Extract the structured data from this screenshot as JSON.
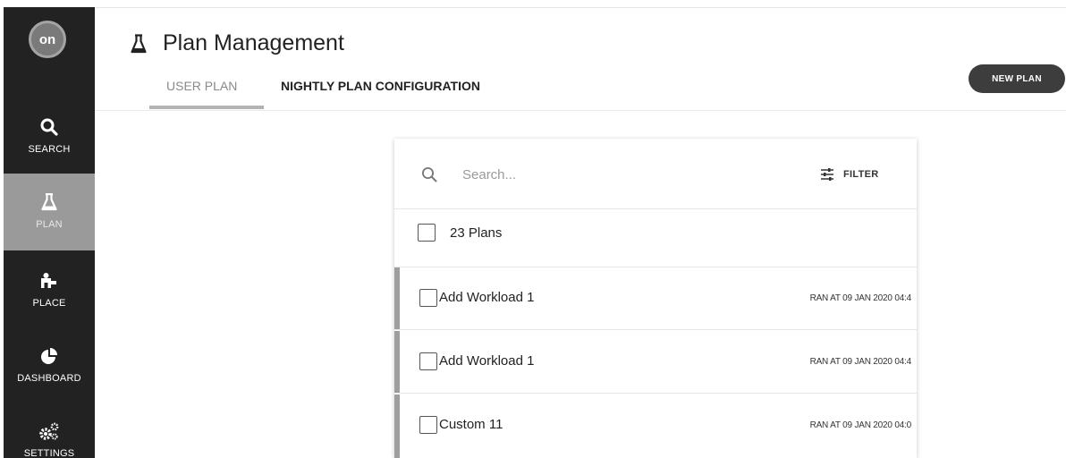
{
  "sidebar": {
    "logo": "on",
    "items": [
      {
        "label": "SEARCH",
        "icon": "search-icon"
      },
      {
        "label": "PLAN",
        "icon": "flask-icon",
        "active": true
      },
      {
        "label": "PLACE",
        "icon": "placement-icon"
      },
      {
        "label": "DASHBOARD",
        "icon": "pie-chart-icon"
      },
      {
        "label": "SETTINGS",
        "icon": "gears-icon"
      }
    ]
  },
  "header": {
    "title": "Plan Management",
    "title_icon": "flask-icon",
    "tabs": [
      {
        "label": "USER PLAN",
        "selected": true
      },
      {
        "label": "NIGHTLY PLAN CONFIGURATION",
        "selected": false
      }
    ],
    "new_plan_label": "NEW PLAN"
  },
  "panel": {
    "search": {
      "placeholder": "Search...",
      "value": ""
    },
    "filter_label": "FILTER",
    "count_label": "23 Plans",
    "plans": [
      {
        "name": "Add Workload 1",
        "ran": "RAN AT 09 JAN 2020 04:4"
      },
      {
        "name": "Add Workload 1",
        "ran": "RAN AT 09 JAN 2020 04:4"
      },
      {
        "name": "Custom 11",
        "ran": "RAN AT 09 JAN 2020 04:0"
      }
    ]
  },
  "colors": {
    "sidebar_bg": "#222222",
    "sidebar_active": "#9a9a9a",
    "button_bg": "#3d3d3d",
    "row_accent": "#9e9e9e"
  }
}
